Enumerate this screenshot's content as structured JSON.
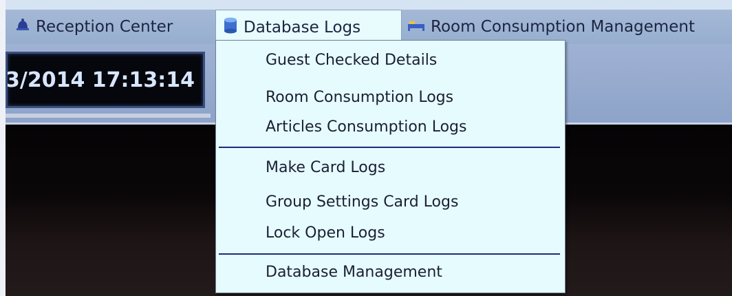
{
  "menubar": {
    "items": [
      {
        "label": "Reception Center",
        "icon": "bell-icon"
      },
      {
        "label": "Database Logs",
        "icon": "database-icon"
      },
      {
        "label": "Room Consumption Management",
        "icon": "bed-icon"
      }
    ]
  },
  "clock": {
    "text": "3/2014 17:13:14"
  },
  "dropdown": {
    "items": [
      "Guest Checked Details",
      "Room Consumption Logs",
      "Articles Consumption Logs",
      "Make Card Logs",
      "Group Settings Card Logs",
      "Lock Open Logs",
      "Database Management"
    ]
  },
  "colors": {
    "menubar": "#9fb3d2",
    "dropdown_bg": "#e6fbfd",
    "separator": "#1c2a78",
    "clock_bg": "#05070d"
  }
}
